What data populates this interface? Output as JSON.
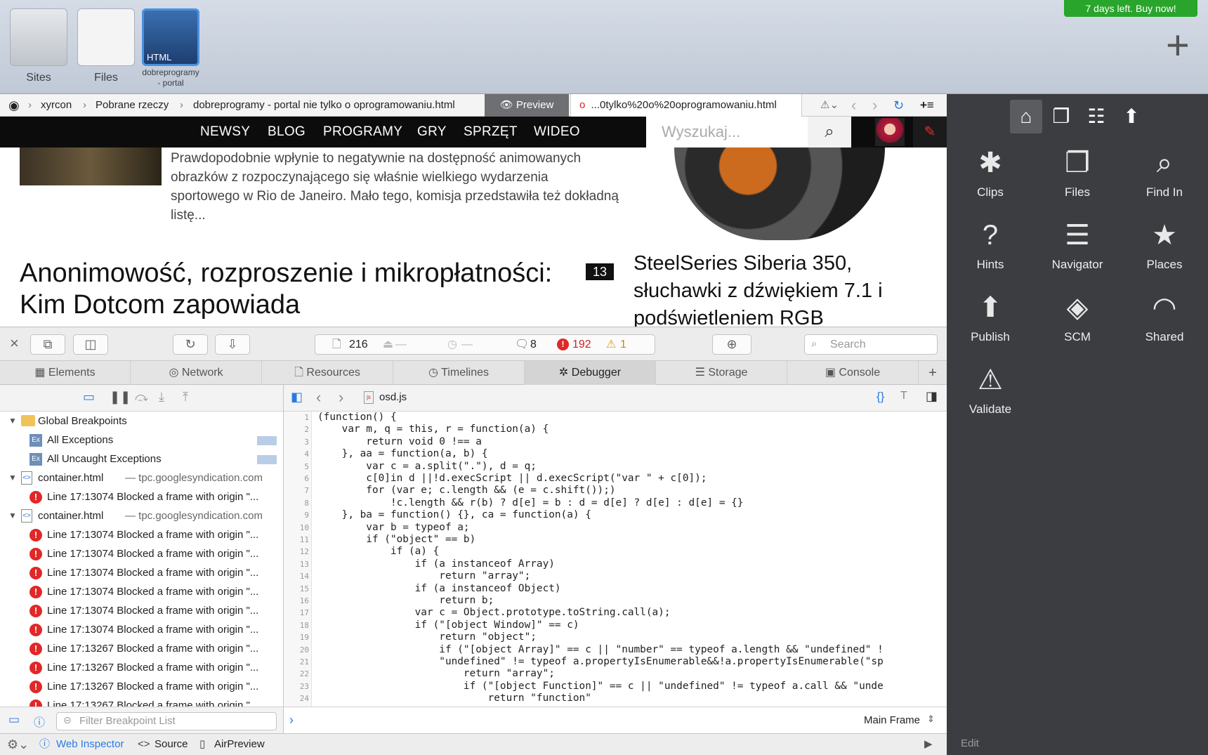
{
  "sites_bar": {
    "items": [
      {
        "label": "Sites"
      },
      {
        "label": "Files"
      },
      {
        "label": "dobreprogramy - portal",
        "badge": "HTML"
      }
    ],
    "trial_badge": "7 days left. Buy now!",
    "add_icon": "plus-icon"
  },
  "breadcrumb": {
    "parts": [
      "xyrcon",
      "Pobrane rzeczy",
      "dobreprogramy - portal nie tylko o oprogramowaniu.html"
    ],
    "preview_label": "Preview",
    "url_tab": "...0tylko%20o%20oprogramowaniu.html"
  },
  "site_nav": {
    "items": [
      "NEWSY",
      "BLOG",
      "PROGRAMY",
      "GRY",
      "SPRZĘT",
      "WIDEO"
    ],
    "search_placeholder": "Wyszukaj..."
  },
  "content": {
    "lead_text": "Prawdopodobnie wpłynie to negatywnie na dostępność animowanych obrazków z rozpoczynającego się właśnie wielkiego wydarzenia sportowego w Rio de Janeiro. Mało tego, komisja przedstawiła też dokładną listę...",
    "headline": "Anonimowość, rozproszenie i mikropłatności: Kim Dotcom zapowiada",
    "comment_count": "13",
    "side_headline": "SteelSeries Siberia 350, słuchawki z dźwiękiem 7.1 i podświetleniem RGB"
  },
  "inspector": {
    "resources_count": "216",
    "resources_dash1": "—",
    "resources_dash2": "—",
    "log_count": "8",
    "error_count": "192",
    "warning_count": "1",
    "search_placeholder": "Search",
    "tabs": [
      "Elements",
      "Network",
      "Resources",
      "Timelines",
      "Debugger",
      "Storage",
      "Console"
    ],
    "active_tab": "Debugger",
    "file_name": "osd.js",
    "breakpoints": {
      "global_label": "Global Breakpoints",
      "all_exceptions": "All Exceptions",
      "all_uncaught": "All Uncaught Exceptions",
      "groups": [
        {
          "file": "container.html",
          "domain": "— tpc.googlesyndication.com",
          "rows": [
            "Line 17:13074 Blocked a frame with origin \"..."
          ]
        },
        {
          "file": "container.html",
          "domain": "— tpc.googlesyndication.com",
          "rows": [
            "Line 17:13074 Blocked a frame with origin \"...",
            "Line 17:13074 Blocked a frame with origin \"...",
            "Line 17:13074 Blocked a frame with origin \"...",
            "Line 17:13074 Blocked a frame with origin \"...",
            "Line 17:13074 Blocked a frame with origin \"...",
            "Line 17:13074 Blocked a frame with origin \"...",
            "Line 17:13267 Blocked a frame with origin \"...",
            "Line 17:13267 Blocked a frame with origin \"...",
            "Line 17:13267 Blocked a frame with origin \"...",
            "Line 17:13267 Blocked a frame with origin \"..."
          ]
        }
      ]
    },
    "filter_placeholder": "Filter Breakpoint List",
    "frame_selector": "Main Frame",
    "code_lines": [
      "(function() {",
      "    var m, q = this, r = function(a) {",
      "        return void 0 !== a",
      "    }, aa = function(a, b) {",
      "        var c = a.split(\".\"), d = q;",
      "        c[0]in d ||!d.execScript || d.execScript(\"var \" + c[0]);",
      "        for (var e; c.length && (e = c.shift());)",
      "            !c.length && r(b) ? d[e] = b : d = d[e] ? d[e] : d[e] = {}",
      "    }, ba = function() {}, ca = function(a) {",
      "        var b = typeof a;",
      "        if (\"object\" == b)",
      "            if (a) {",
      "                if (a instanceof Array)",
      "                    return \"array\";",
      "                if (a instanceof Object)",
      "                    return b;",
      "                var c = Object.prototype.toString.call(a);",
      "                if (\"[object Window]\" == c)",
      "                    return \"object\";",
      "                    if (\"[object Array]\" == c || \"number\" == typeof a.length && \"undefined\" !",
      "                    \"undefined\" != typeof a.propertyIsEnumerable&&!a.propertyIsEnumerable(\"sp",
      "                        return \"array\";",
      "                        if (\"[object Function]\" == c || \"undefined\" != typeof a.call && \"unde",
      "                            return \"function\""
    ],
    "bottom": {
      "web_inspector": "Web Inspector",
      "source": "Source",
      "airpreview": "AirPreview"
    }
  },
  "right_panel": {
    "items": [
      "Clips",
      "Files",
      "Find In",
      "Hints",
      "Navigator",
      "Places",
      "Publish",
      "SCM",
      "Shared",
      "Validate"
    ],
    "edit_label": "Edit"
  }
}
